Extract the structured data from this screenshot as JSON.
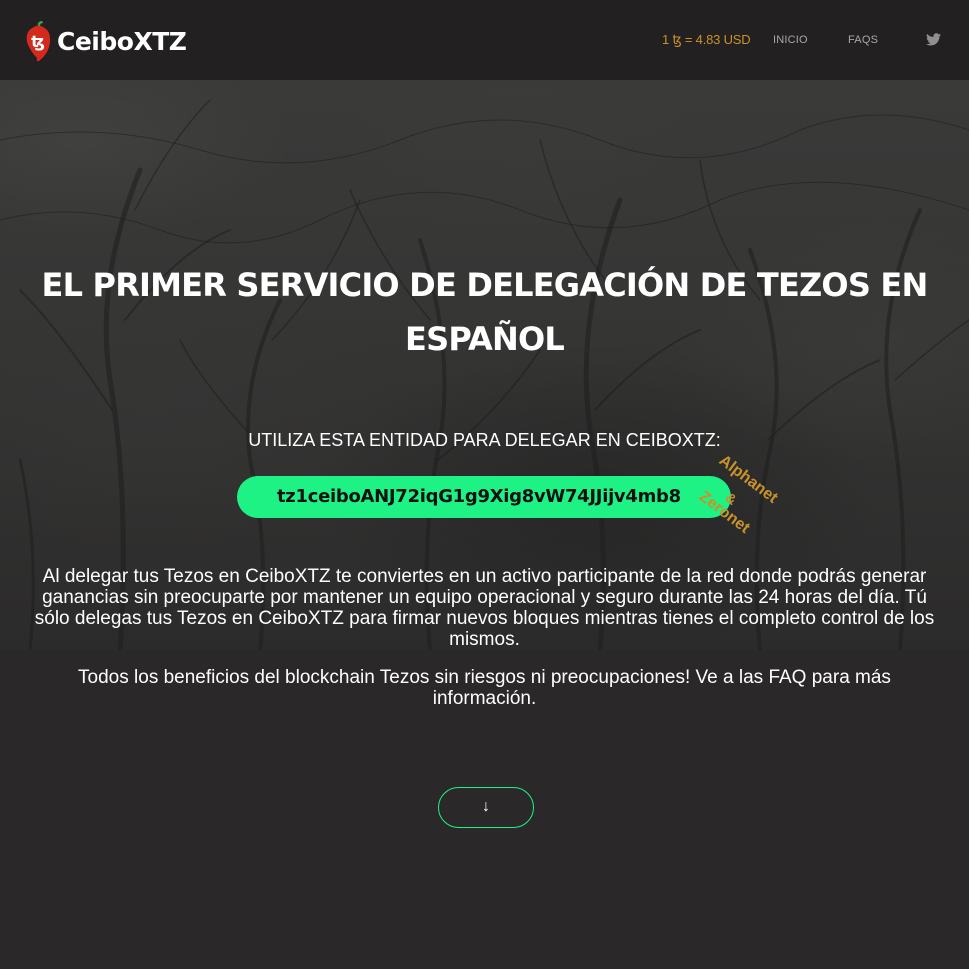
{
  "navbar": {
    "brand_name": "CeiboXTZ",
    "price_label": "1 ꜩ = 4.83 USD",
    "links": [
      {
        "label": "INICIO"
      },
      {
        "label": "FAQS"
      }
    ],
    "social_icon": "twitter-icon"
  },
  "hero": {
    "headline_line1": "EL PRIMER SERVICIO DE DELEGACIÓN DE TEZOS EN",
    "headline_line2": "ESPAÑOL",
    "delegate_label": "UTILIZA ESTA ENTIDAD PARA DELEGAR EN CEIBOXTZ:",
    "address": "tz1ceiboANJ72iqG1g9Xig8vW74JJijv4mb8",
    "network_tags": [
      "Alphanet",
      "&",
      "Zeronet"
    ],
    "description": "Al delegar tus Tezos en CeiboXTZ te conviertes en un activo participante de la red donde podrás generar ganancias sin preocuparte por mantener un equipo operacional y seguro durante las 24 horas del día. Tú sólo delegas tus Tezos en CeiboXTZ para firmar nuevos bloques mientras tienes el completo control de los mismos.",
    "benefits": "Todos los beneficios del blockchain Tezos sin riesgos ni preocupaciones! Ve a las FAQ para más información.",
    "scroll_button_glyph": "↓"
  },
  "colors": {
    "accent_green": "#1ef285",
    "accent_gold": "#c9922a",
    "navbar_bg": "#222021",
    "page_bg": "#2a2829",
    "logo_red": "#d42a1e"
  }
}
